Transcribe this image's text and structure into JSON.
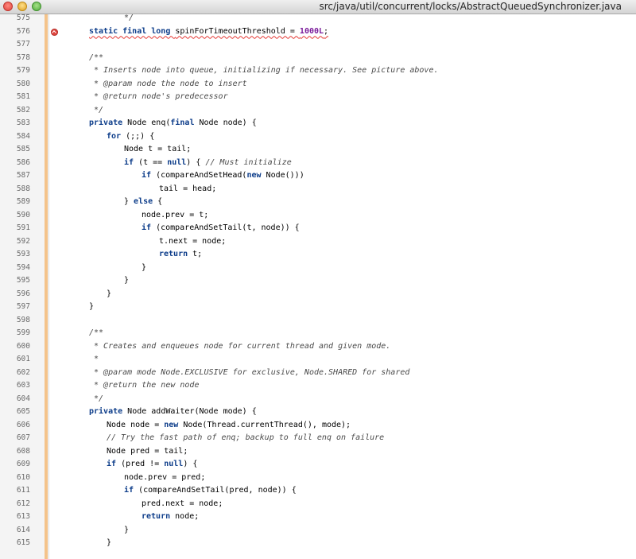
{
  "window": {
    "title": "src/java/util/concurrent/locks/AbstractQueuedSynchronizer.java",
    "buttons": {
      "close": "×",
      "minimize": "−",
      "maximize": "+"
    }
  },
  "editor": {
    "error_line": 576,
    "lines": [
      {
        "n": "575",
        "tokens": [
          [
            "cm",
            "*/"
          ]
        ],
        "indent": 2
      },
      {
        "n": "576",
        "tokens": [
          [
            "kw",
            "static final long "
          ],
          [
            "t",
            "spinForTimeoutThreshold = "
          ],
          [
            "num",
            "1000L"
          ],
          [
            "t",
            ";"
          ]
        ],
        "indent": 0,
        "error": true
      },
      {
        "n": "577",
        "tokens": [],
        "indent": 0
      },
      {
        "n": "578",
        "tokens": [
          [
            "cm",
            "/**"
          ]
        ],
        "indent": 0
      },
      {
        "n": "579",
        "tokens": [
          [
            "cm",
            " * Inserts node into queue, initializing if necessary. See picture above."
          ]
        ],
        "indent": 0
      },
      {
        "n": "580",
        "tokens": [
          [
            "cm",
            " * @param node the node to insert"
          ]
        ],
        "indent": 0
      },
      {
        "n": "581",
        "tokens": [
          [
            "cm",
            " * @return node's predecessor"
          ]
        ],
        "indent": 0
      },
      {
        "n": "582",
        "tokens": [
          [
            "cm",
            " */"
          ]
        ],
        "indent": 0
      },
      {
        "n": "583",
        "tokens": [
          [
            "kw",
            "private "
          ],
          [
            "t",
            "Node enq("
          ],
          [
            "kw",
            "final "
          ],
          [
            "t",
            "Node node) {"
          ]
        ],
        "indent": 0
      },
      {
        "n": "584",
        "tokens": [
          [
            "kw",
            "for "
          ],
          [
            "t",
            "(;;) {"
          ]
        ],
        "indent": 1
      },
      {
        "n": "585",
        "tokens": [
          [
            "t",
            "Node t = tail;"
          ]
        ],
        "indent": 2
      },
      {
        "n": "586",
        "tokens": [
          [
            "kw",
            "if "
          ],
          [
            "t",
            "(t == "
          ],
          [
            "kw",
            "null"
          ],
          [
            "t",
            ") { "
          ],
          [
            "cm",
            "// Must initialize"
          ]
        ],
        "indent": 2
      },
      {
        "n": "587",
        "tokens": [
          [
            "kw",
            "if "
          ],
          [
            "t",
            "(compareAndSetHead("
          ],
          [
            "kw",
            "new "
          ],
          [
            "t",
            "Node()))"
          ]
        ],
        "indent": 3
      },
      {
        "n": "588",
        "tokens": [
          [
            "t",
            "tail = head;"
          ]
        ],
        "indent": 4
      },
      {
        "n": "589",
        "tokens": [
          [
            "t",
            "} "
          ],
          [
            "kw",
            "else "
          ],
          [
            "t",
            "{"
          ]
        ],
        "indent": 2
      },
      {
        "n": "590",
        "tokens": [
          [
            "t",
            "node.prev = t;"
          ]
        ],
        "indent": 3
      },
      {
        "n": "591",
        "tokens": [
          [
            "kw",
            "if "
          ],
          [
            "t",
            "(compareAndSetTail(t, node)) {"
          ]
        ],
        "indent": 3
      },
      {
        "n": "592",
        "tokens": [
          [
            "t",
            "t.next = node;"
          ]
        ],
        "indent": 4
      },
      {
        "n": "593",
        "tokens": [
          [
            "kw",
            "return "
          ],
          [
            "t",
            "t;"
          ]
        ],
        "indent": 4
      },
      {
        "n": "594",
        "tokens": [
          [
            "t",
            "}"
          ]
        ],
        "indent": 3
      },
      {
        "n": "595",
        "tokens": [
          [
            "t",
            "}"
          ]
        ],
        "indent": 2
      },
      {
        "n": "596",
        "tokens": [
          [
            "t",
            "}"
          ]
        ],
        "indent": 1
      },
      {
        "n": "597",
        "tokens": [
          [
            "t",
            "}"
          ]
        ],
        "indent": 0
      },
      {
        "n": "598",
        "tokens": [],
        "indent": 0
      },
      {
        "n": "599",
        "tokens": [
          [
            "cm",
            "/**"
          ]
        ],
        "indent": 0
      },
      {
        "n": "600",
        "tokens": [
          [
            "cm",
            " * Creates and enqueues node for current thread and given mode."
          ]
        ],
        "indent": 0
      },
      {
        "n": "601",
        "tokens": [
          [
            "cm",
            " *"
          ]
        ],
        "indent": 0
      },
      {
        "n": "602",
        "tokens": [
          [
            "cm",
            " * @param mode Node.EXCLUSIVE for exclusive, Node.SHARED for shared"
          ]
        ],
        "indent": 0
      },
      {
        "n": "603",
        "tokens": [
          [
            "cm",
            " * @return the new node"
          ]
        ],
        "indent": 0
      },
      {
        "n": "604",
        "tokens": [
          [
            "cm",
            " */"
          ]
        ],
        "indent": 0
      },
      {
        "n": "605",
        "tokens": [
          [
            "kw",
            "private "
          ],
          [
            "t",
            "Node addWaiter(Node mode) {"
          ]
        ],
        "indent": 0
      },
      {
        "n": "606",
        "tokens": [
          [
            "t",
            "Node node = "
          ],
          [
            "kw",
            "new "
          ],
          [
            "t",
            "Node(Thread.currentThread(), mode);"
          ]
        ],
        "indent": 1
      },
      {
        "n": "607",
        "tokens": [
          [
            "cm",
            "// Try the fast path of enq; backup to full enq on failure"
          ]
        ],
        "indent": 1
      },
      {
        "n": "608",
        "tokens": [
          [
            "t",
            "Node pred = tail;"
          ]
        ],
        "indent": 1
      },
      {
        "n": "609",
        "tokens": [
          [
            "kw",
            "if "
          ],
          [
            "t",
            "(pred != "
          ],
          [
            "kw",
            "null"
          ],
          [
            "t",
            ") {"
          ]
        ],
        "indent": 1
      },
      {
        "n": "610",
        "tokens": [
          [
            "t",
            "node.prev = pred;"
          ]
        ],
        "indent": 2
      },
      {
        "n": "611",
        "tokens": [
          [
            "kw",
            "if "
          ],
          [
            "t",
            "(compareAndSetTail(pred, node)) {"
          ]
        ],
        "indent": 2
      },
      {
        "n": "612",
        "tokens": [
          [
            "t",
            "pred.next = node;"
          ]
        ],
        "indent": 3
      },
      {
        "n": "613",
        "tokens": [
          [
            "kw",
            "return "
          ],
          [
            "t",
            "node;"
          ]
        ],
        "indent": 3
      },
      {
        "n": "614",
        "tokens": [
          [
            "t",
            "}"
          ]
        ],
        "indent": 2
      },
      {
        "n": "615",
        "tokens": [
          [
            "t",
            "}"
          ]
        ],
        "indent": 1
      }
    ]
  }
}
